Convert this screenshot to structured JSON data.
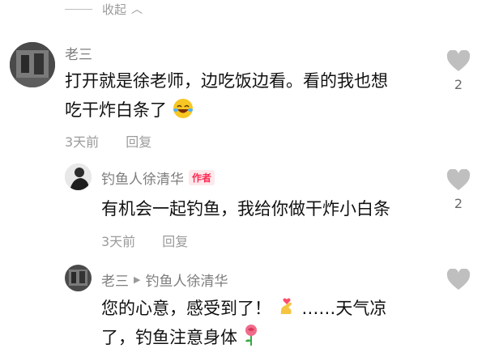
{
  "collapse": {
    "label": "收起"
  },
  "comments": [
    {
      "user": "老三",
      "text_line1": "打开就是徐老师，边吃饭边看。看的我也想",
      "text_line2": "吃干炸白条了",
      "time": "3天前",
      "reply": "回复",
      "likes": "2"
    },
    {
      "user": "钓鱼人徐清华",
      "badge": "作者",
      "text": "有机会一起钓鱼，我给你做干炸小白条",
      "time": "3天前",
      "reply": "回复",
      "likes": "2"
    },
    {
      "user": "老三",
      "reply_to": "钓鱼人徐清华",
      "text_line1a": "您的心意，感受到了！",
      "text_line1b": "……天气凉",
      "text_line2": "了，钓鱼注意身体"
    }
  ],
  "colors": {
    "accent": "#fe2c55",
    "muted": "#9b9b9b",
    "heart": "#bfbfbf"
  },
  "icons": [
    "chevron-up-icon",
    "heart-icon",
    "laughing-emoji-icon",
    "finger-heart-emoji-icon",
    "rose-emoji-icon",
    "reply-arrow-icon"
  ]
}
